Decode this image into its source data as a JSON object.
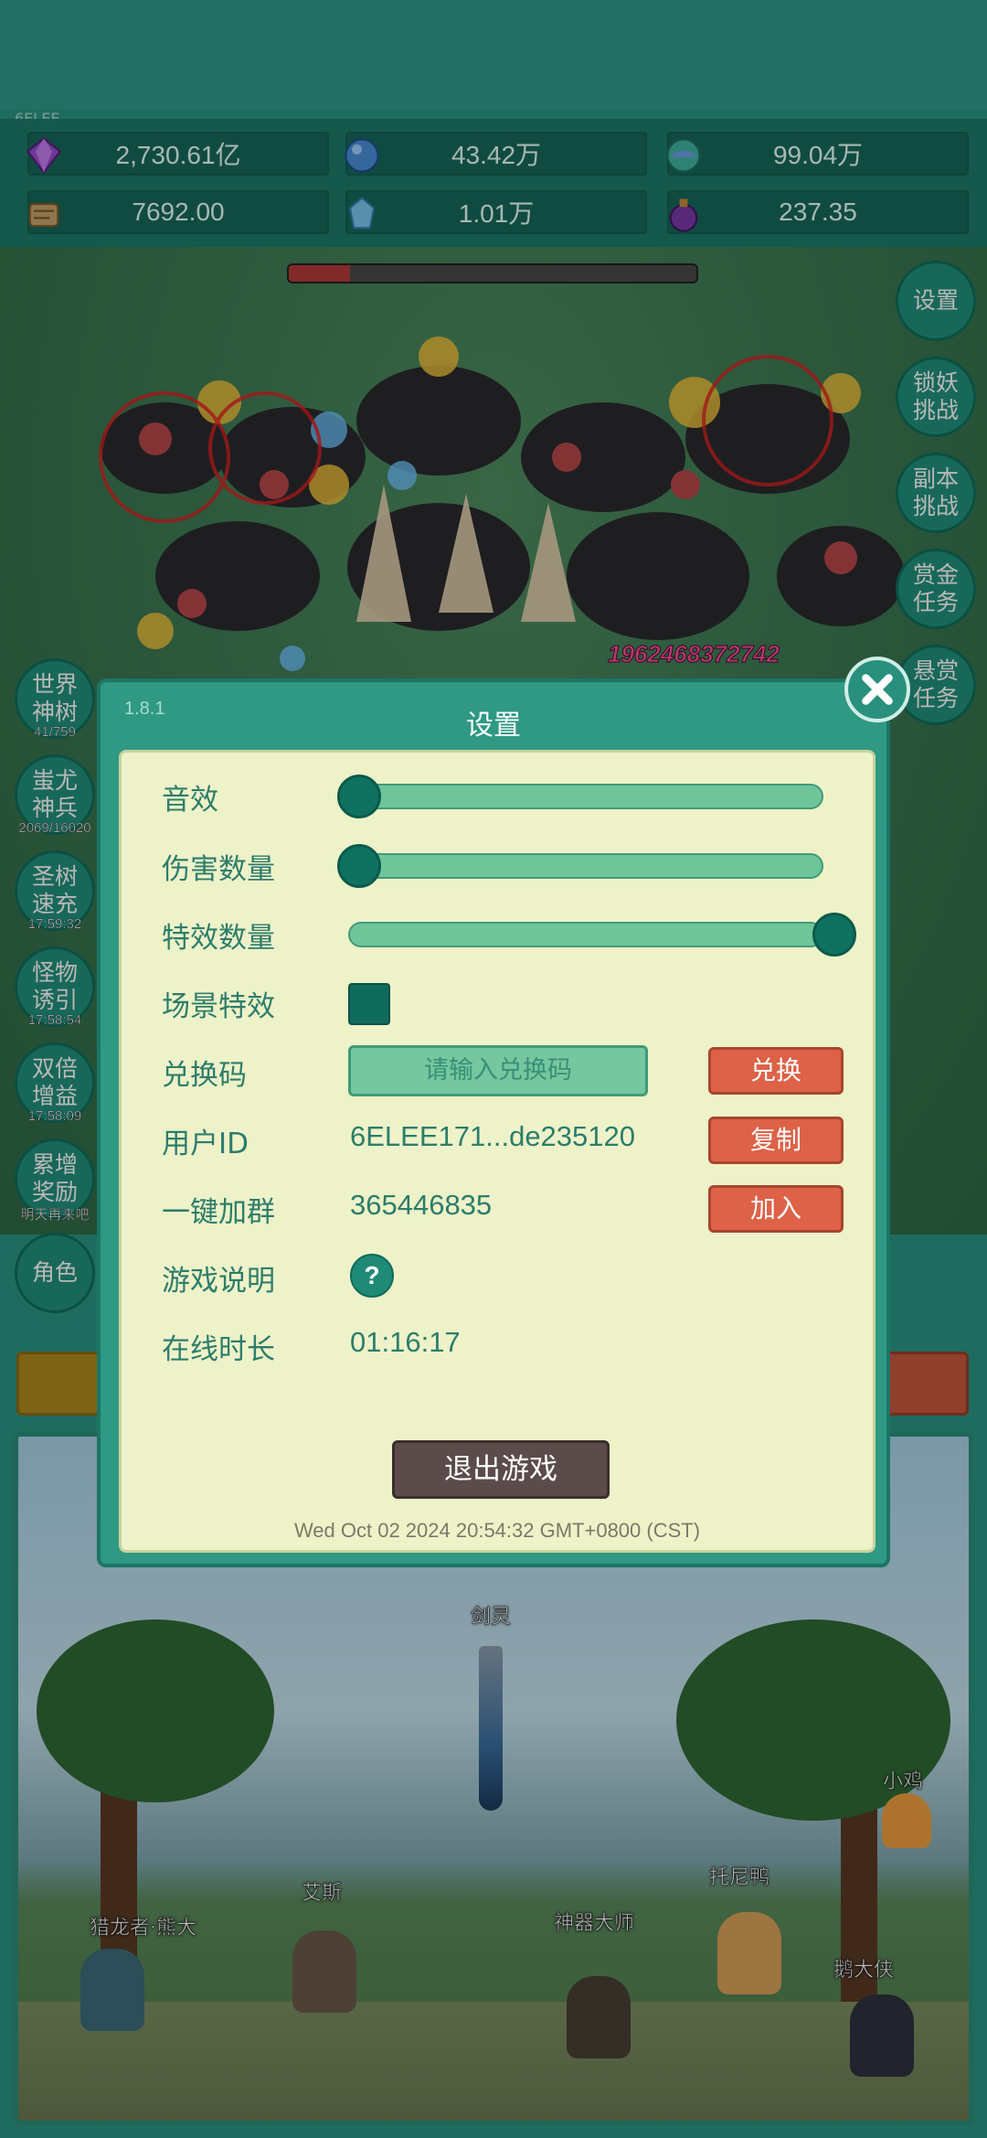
{
  "account": {
    "tag": "6ELEE"
  },
  "resources": [
    {
      "icon": "purple-gem-icon",
      "value": "2,730.61亿",
      "color": "#9a4fd0"
    },
    {
      "icon": "blue-orb-icon",
      "value": "43.42万",
      "color": "#4a8fd8"
    },
    {
      "icon": "green-blue-orb-icon",
      "value": "99.04万",
      "color": "#3fb4a0"
    },
    {
      "icon": "scroll-icon",
      "value": "7692.00",
      "color": "#c7a46a"
    },
    {
      "icon": "ice-crystal-icon",
      "value": "1.01万",
      "color": "#7cc6f0"
    },
    {
      "icon": "purple-potion-icon",
      "value": "237.35",
      "color": "#7a3aa8"
    }
  ],
  "battle": {
    "boss_hp_fraction": 0.15,
    "damage": "19624683727̣42"
  },
  "right_menu": [
    {
      "label": "设置"
    },
    {
      "label": "锁妖挑战"
    },
    {
      "label": "副本挑战"
    },
    {
      "label": "赏金任务"
    },
    {
      "label": "悬赏任务"
    }
  ],
  "left_menu": [
    {
      "label": "世界神树",
      "sub": "41/759"
    },
    {
      "label": "蚩尤神兵",
      "sub": "2069/16020"
    },
    {
      "label": "圣树速充",
      "sub": "17:59:32"
    },
    {
      "label": "怪物诱引",
      "sub": "17:58:54"
    },
    {
      "label": "双倍增益",
      "sub": "17:58:09"
    },
    {
      "label": "累增奖励",
      "sub": "明天再来吧"
    },
    {
      "label": "角色",
      "sub": ""
    }
  ],
  "scene": {
    "labels": {
      "sword": "剑灵",
      "chicken": "小鸡",
      "bear": "猎龙者·熊大",
      "ace": "艾斯",
      "master": "神器大师",
      "duck": "托尼鸭",
      "goose": "鹅大侠"
    }
  },
  "dialog": {
    "version": "1.8.1",
    "title": "设置",
    "sound_label": "音效",
    "sound_level": 0,
    "damage_count_label": "伤害数量",
    "damage_count_level": 0,
    "effect_count_label": "特效数量",
    "effect_count_level": 1,
    "scene_effect_label": "场景特效",
    "scene_effect_checked": true,
    "redeem_label": "兑换码",
    "redeem_placeholder": "请输入兑换码",
    "redeem_button": "兑换",
    "user_id_label": "用户ID",
    "user_id_value": "6ELEE171...de235120",
    "copy_button": "复制",
    "join_group_label": "一键加群",
    "group_number": "365446835",
    "join_button": "加入",
    "game_info_label": "游戏说明",
    "help_symbol": "?",
    "online_time_label": "在线时长",
    "online_time_value": "01:16:17",
    "exit_button": "退出游戏",
    "timestamp": "Wed Oct 02 2024 20:54:32 GMT+0800 (CST)"
  }
}
